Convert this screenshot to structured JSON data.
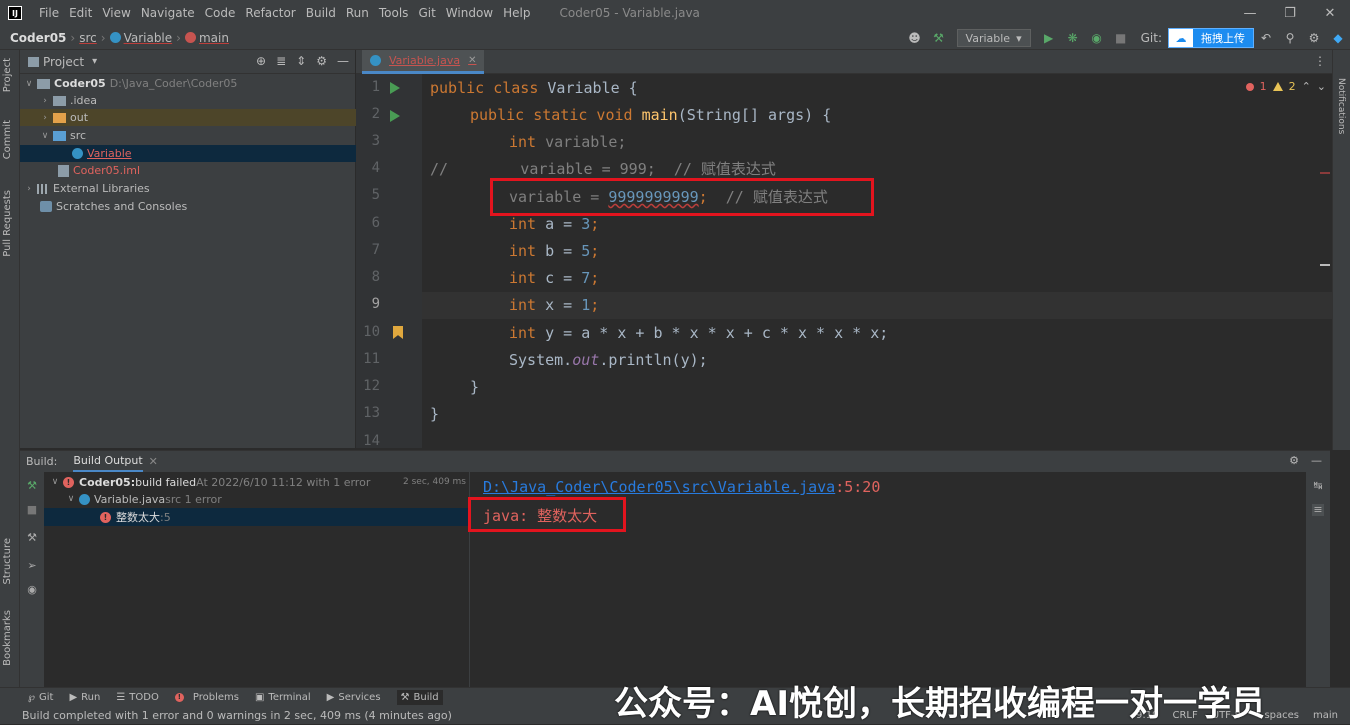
{
  "window": {
    "title": "Coder05 - Variable.java",
    "menu": [
      "File",
      "Edit",
      "View",
      "Navigate",
      "Code",
      "Refactor",
      "Build",
      "Run",
      "Tools",
      "Git",
      "Window",
      "Help"
    ]
  },
  "breadcrumb": {
    "project": "Coder05",
    "src": "src",
    "file": "Variable",
    "method": "main"
  },
  "toolbar": {
    "run_config": "Variable",
    "git_label": "Git:",
    "upload_label": "拖拽上传"
  },
  "project_panel": {
    "title": "Project",
    "tree": [
      {
        "label": "Coder05",
        "path": "D:\\Java_Coder\\Coder05"
      },
      {
        "label": ".idea"
      },
      {
        "label": "out"
      },
      {
        "label": "src"
      },
      {
        "label": "Variable"
      },
      {
        "label": "Coder05.iml"
      },
      {
        "label": "External Libraries"
      },
      {
        "label": "Scratches and Consoles"
      }
    ]
  },
  "editor": {
    "tab": "Variable.java",
    "indicator": {
      "errors": "1",
      "warnings": "2"
    },
    "line_numbers": [
      "1",
      "2",
      "3",
      "4",
      "5",
      "6",
      "7",
      "8",
      "9",
      "10",
      "11",
      "12",
      "13",
      "14"
    ],
    "lines": {
      "l1_kw": "public class ",
      "l1_rest": "Variable {",
      "l2_kw": "public static void ",
      "l2_fn": "main",
      "l2_rest": "(String[] args) {",
      "l3_kw": "int ",
      "l3_rest": "variable;",
      "l4": "//        variable = 999;  // 赋值表达式",
      "l5_a": "variable = ",
      "l5_num": "9999999999",
      "l5_b": ";  ",
      "l5_cm": "// 赋值表达式",
      "l6_kw": "int ",
      "l6_a": "a = ",
      "l6_num": "3",
      "l6_end": ";",
      "l7_kw": "int ",
      "l7_a": "b = ",
      "l7_num": "5",
      "l7_end": ";",
      "l8_kw": "int ",
      "l8_a": "c = ",
      "l8_num": "7",
      "l8_end": ";",
      "l9_kw": "int ",
      "l9_a": "x = ",
      "l9_num": "1",
      "l9_end": ";",
      "l10_kw": "int ",
      "l10_rest": "y = a * x + b * x * x + c * x * x * x;",
      "l11_a": "System.",
      "l11_out": "out",
      "l11_b": ".println(y);",
      "l12": "}",
      "l13": "}"
    }
  },
  "build": {
    "label": "Build:",
    "tab": "Build Output",
    "root": "Coder05:",
    "root_status": " build failed",
    "root_detail": " At 2022/6/10 11:12 with 1 error",
    "root_time": "2 sec, 409 ms",
    "file": "Variable.java",
    "file_detail": " src 1 error",
    "error": "整数太大",
    "error_loc": " :5",
    "output_path": "D:\\Java_Coder\\Coder05\\src\\Variable.java",
    "output_loc": ":5:20",
    "output_error": "java: 整数太大"
  },
  "tool_tabs": [
    "Git",
    "Run",
    "TODO",
    "Problems",
    "Terminal",
    "Services",
    "Build"
  ],
  "side_tabs": {
    "project": "Project",
    "commit": "Commit",
    "pull": "Pull Requests",
    "structure": "Structure",
    "bookmarks": "Bookmarks",
    "notifications": "Notifications"
  },
  "statusbar": {
    "message": "Build completed with 1 error and 0 warnings in 2 sec, 409 ms (4 minutes ago)",
    "position": "9:19",
    "line_sep": "CRLF",
    "encoding": "UTF-8",
    "indent": "4 spaces",
    "branch": "main"
  },
  "watermark": "公众号：AI悦创，长期招收编程一对一学员"
}
